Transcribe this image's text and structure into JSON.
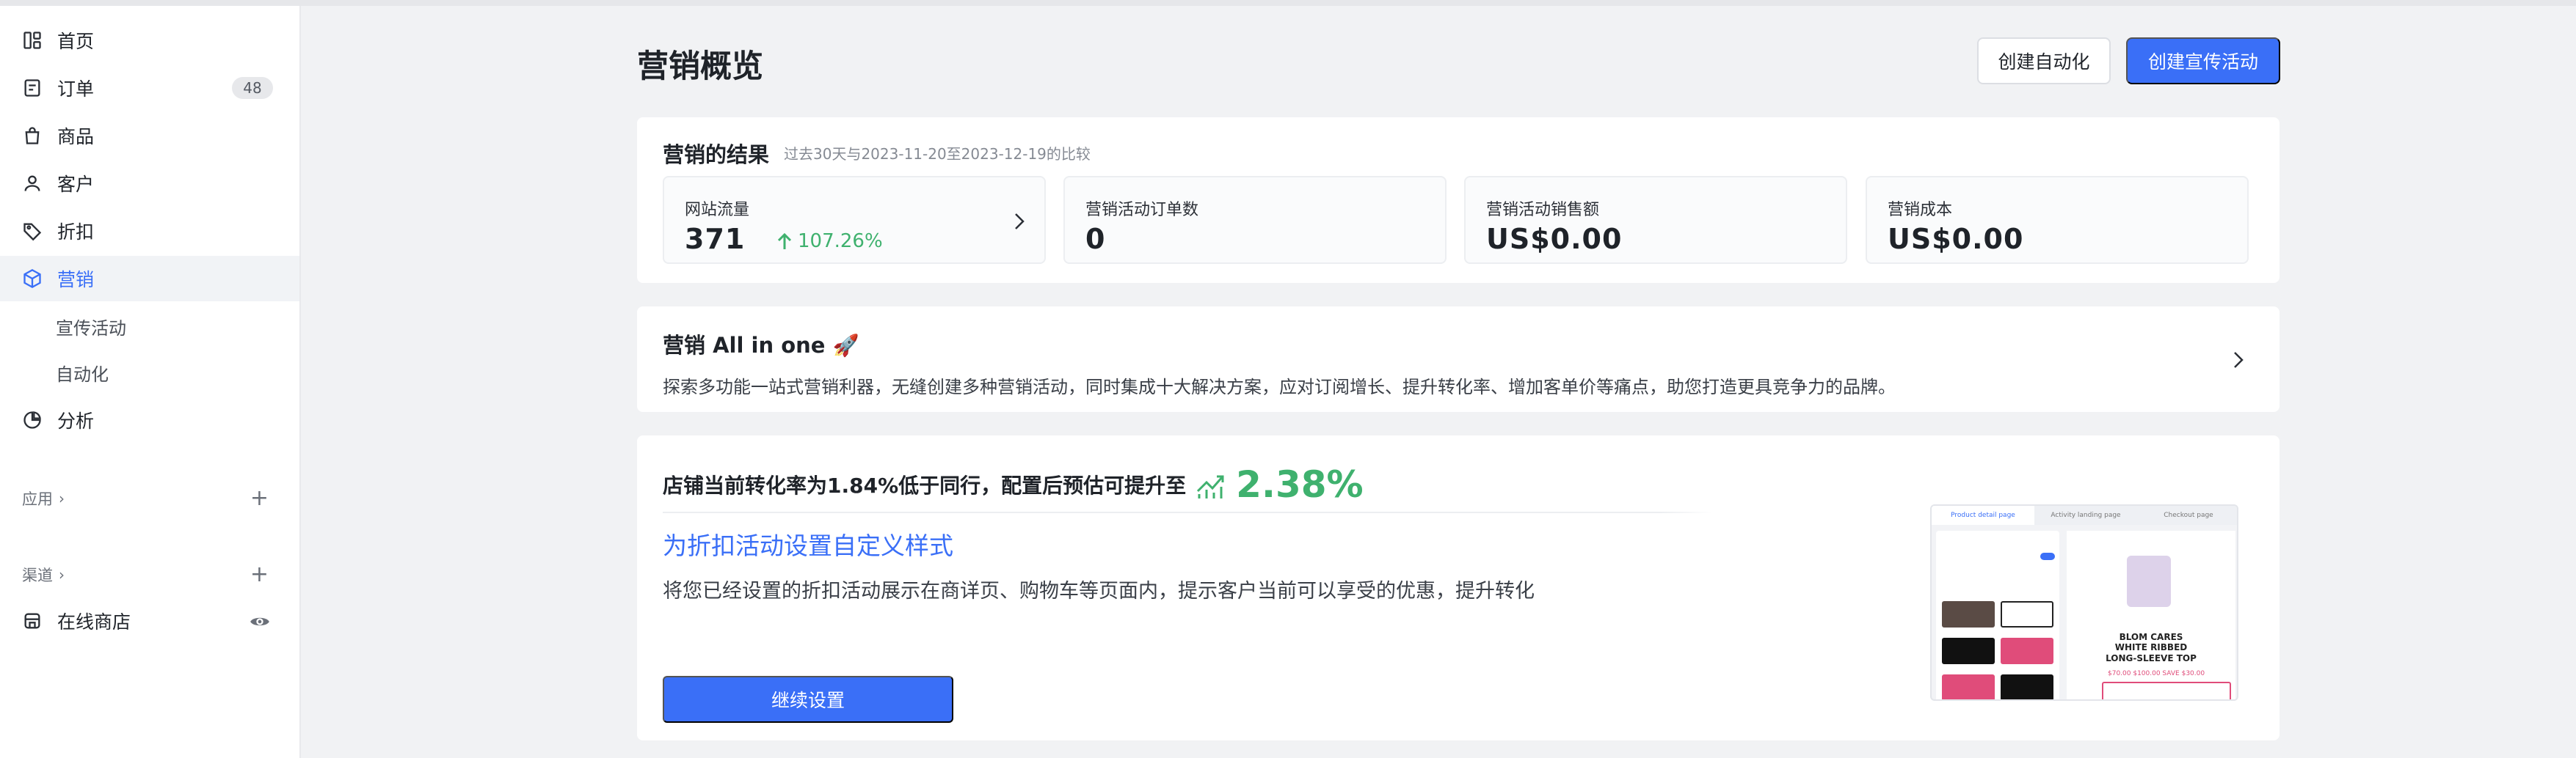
{
  "sidebar": {
    "items": [
      {
        "label": "首页",
        "icon": "dashboard-icon"
      },
      {
        "label": "订单",
        "icon": "order-icon",
        "badge": "48"
      },
      {
        "label": "商品",
        "icon": "product-bag-icon"
      },
      {
        "label": "客户",
        "icon": "customer-icon"
      },
      {
        "label": "折扣",
        "icon": "discount-tag-icon"
      },
      {
        "label": "营销",
        "icon": "marketing-cube-icon",
        "active": true
      }
    ],
    "sub_items": [
      "宣传活动",
      "自动化"
    ],
    "analytics": {
      "label": "分析",
      "icon": "analytics-pie-icon"
    },
    "apps_section": "应用",
    "channels_section": "渠道",
    "online_store": "在线商店"
  },
  "header": {
    "title": "营销概览",
    "create_automation": "创建自动化",
    "create_campaign": "创建宣传活动"
  },
  "results": {
    "title": "营销的结果",
    "subtitle": "过去30天与2023-11-20至2023-12-19的比较",
    "metrics": [
      {
        "label": "网站流量",
        "value": "371",
        "delta": "107.26%"
      },
      {
        "label": "营销活动订单数",
        "value": "0"
      },
      {
        "label": "营销活动销售额",
        "value": "US$0.00"
      },
      {
        "label": "营销成本",
        "value": "US$0.00"
      }
    ]
  },
  "allinone": {
    "title": "营销 All in one 🚀",
    "description": "探索多功能一站式营销利器，无缝创建多种营销活动，同时集成十大解决方案，应对订阅增长、提升转化率、增加客单价等痛点，助您打造更具竞争力的品牌。"
  },
  "conversion": {
    "text": "店铺当前转化率为1.84%低于同行，配置后预估可提升至",
    "target_pct": "2.38%",
    "promo_title": "为折扣活动设置自定义样式",
    "promo_desc": "将您已经设置的折扣活动展示在商详页、购物车等页面内，提示客户当前可以享受的优惠，提升转化",
    "continue_button": "继续设置",
    "preview": {
      "tabs": [
        "Product detail page",
        "Activity landing page",
        "Checkout page"
      ],
      "headline": "BLOM CARES WHITE RIBBED LONG-SLEEVE TOP",
      "price": "$70.00  $100.00  SAVE $30.00"
    }
  },
  "colors": {
    "accent": "#3a6ff7",
    "positive": "#3fb16e"
  }
}
